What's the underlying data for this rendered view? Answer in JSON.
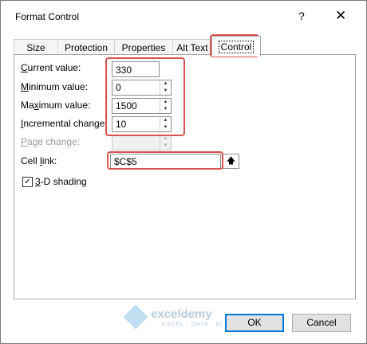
{
  "window": {
    "title": "Format Control",
    "help": "?",
    "close": "✕"
  },
  "tabs": [
    "Size",
    "Protection",
    "Properties",
    "Alt Text",
    "Control"
  ],
  "fields": {
    "current_label_key": "C",
    "current_label_rest": "urrent value:",
    "current_value": "330",
    "min_label_key": "M",
    "min_label_rest": "inimum value:",
    "min_value": "0",
    "max_label_pre": "Ma",
    "max_label_key": "x",
    "max_label_rest": "imum value:",
    "max_value": "1500",
    "incr_label_key": "I",
    "incr_label_rest": "ncremental change:",
    "incr_value": "10",
    "page_label_key": "P",
    "page_label_rest": "age change:",
    "cell_label_pre": "Cell ",
    "cell_label_key": "l",
    "cell_label_rest": "ink:",
    "cell_value": "$C$5",
    "range_button_icon": "up-arrow-icon",
    "shading_key": "3",
    "shading_rest": "-D shading",
    "shading_checked": true
  },
  "buttons": {
    "ok": "OK",
    "cancel": "Cancel"
  },
  "watermark": {
    "name": "exceldemy",
    "tagline": "EXCEL · DATA · BI"
  },
  "colors": {
    "highlight": "#d9534f",
    "default_button_border": "#0078d7"
  }
}
